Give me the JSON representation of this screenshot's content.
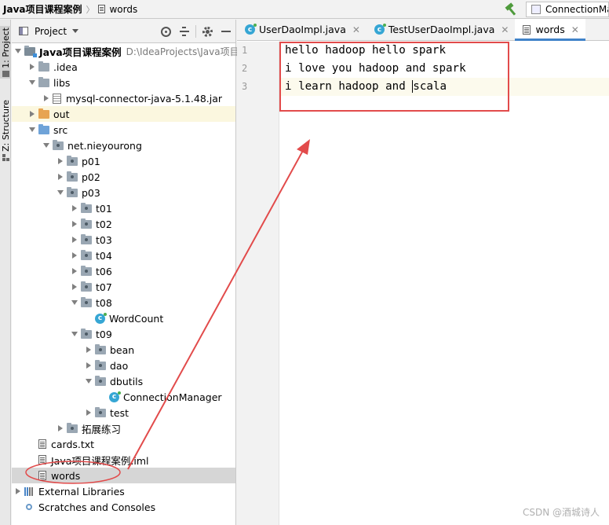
{
  "navbar": {
    "project": "Java项目课程案例",
    "file": "words",
    "run_config": "ConnectionMa"
  },
  "strip": {
    "project_label": "1: Project",
    "structure_label": "Z: Structure"
  },
  "panel": {
    "title": "Project",
    "tree": [
      {
        "indent": 0,
        "arrow": "down",
        "icon": "module",
        "label": "Java项目课程案例",
        "bold": true,
        "path": "D:\\IdeaProjects\\Java项目"
      },
      {
        "indent": 1,
        "arrow": "right",
        "icon": "folder",
        "label": ".idea"
      },
      {
        "indent": 1,
        "arrow": "down",
        "icon": "folder",
        "label": "libs"
      },
      {
        "indent": 2,
        "arrow": "right",
        "icon": "jar",
        "label": "mysql-connector-java-5.1.48.jar"
      },
      {
        "indent": 1,
        "arrow": "right",
        "icon": "folder-orange",
        "label": "out",
        "hl": "out"
      },
      {
        "indent": 1,
        "arrow": "down",
        "icon": "folder-blue",
        "label": "src"
      },
      {
        "indent": 2,
        "arrow": "down",
        "icon": "package",
        "label": "net.nieyourong"
      },
      {
        "indent": 3,
        "arrow": "right",
        "icon": "package",
        "label": "p01"
      },
      {
        "indent": 3,
        "arrow": "right",
        "icon": "package",
        "label": "p02"
      },
      {
        "indent": 3,
        "arrow": "down",
        "icon": "package",
        "label": "p03"
      },
      {
        "indent": 4,
        "arrow": "right",
        "icon": "package",
        "label": "t01"
      },
      {
        "indent": 4,
        "arrow": "right",
        "icon": "package",
        "label": "t02"
      },
      {
        "indent": 4,
        "arrow": "right",
        "icon": "package",
        "label": "t03"
      },
      {
        "indent": 4,
        "arrow": "right",
        "icon": "package",
        "label": "t04"
      },
      {
        "indent": 4,
        "arrow": "right",
        "icon": "package",
        "label": "t06"
      },
      {
        "indent": 4,
        "arrow": "right",
        "icon": "package",
        "label": "t07"
      },
      {
        "indent": 4,
        "arrow": "down",
        "icon": "package",
        "label": "t08"
      },
      {
        "indent": 5,
        "arrow": "none",
        "icon": "class",
        "label": "WordCount"
      },
      {
        "indent": 4,
        "arrow": "down",
        "icon": "package",
        "label": "t09"
      },
      {
        "indent": 5,
        "arrow": "right",
        "icon": "package",
        "label": "bean"
      },
      {
        "indent": 5,
        "arrow": "right",
        "icon": "package",
        "label": "dao"
      },
      {
        "indent": 5,
        "arrow": "down",
        "icon": "package",
        "label": "dbutils"
      },
      {
        "indent": 6,
        "arrow": "none",
        "icon": "class",
        "label": "ConnectionManager"
      },
      {
        "indent": 5,
        "arrow": "right",
        "icon": "package",
        "label": "test"
      },
      {
        "indent": 3,
        "arrow": "right",
        "icon": "package",
        "label": "拓展练习"
      },
      {
        "indent": 1,
        "arrow": "none",
        "icon": "text",
        "label": "cards.txt"
      },
      {
        "indent": 1,
        "arrow": "none",
        "icon": "text",
        "label": "Java项目课程案例.iml"
      },
      {
        "indent": 1,
        "arrow": "none",
        "icon": "text",
        "label": "words",
        "hl": "sel"
      },
      {
        "indent": 0,
        "arrow": "right",
        "icon": "libraries",
        "label": "External Libraries"
      },
      {
        "indent": 0,
        "arrow": "none",
        "icon": "scratches",
        "label": "Scratches and Consoles"
      }
    ]
  },
  "editor": {
    "tabs": [
      {
        "label": "UserDaoImpl.java",
        "icon": "class",
        "active": false
      },
      {
        "label": "TestUserDaoImpl.java",
        "icon": "class",
        "active": false
      },
      {
        "label": "words",
        "icon": "text",
        "active": true
      }
    ],
    "lines": [
      {
        "num": "1",
        "text": "hello hadoop hello spark"
      },
      {
        "num": "2",
        "text": "i love you hadoop and spark"
      },
      {
        "num": "3",
        "text_before_caret": "i learn hadoop and ",
        "text_after_caret": "scala",
        "current": true
      }
    ]
  },
  "annotation": {
    "color": "#e24b4b"
  },
  "watermark": "CSDN @酒城诗人"
}
